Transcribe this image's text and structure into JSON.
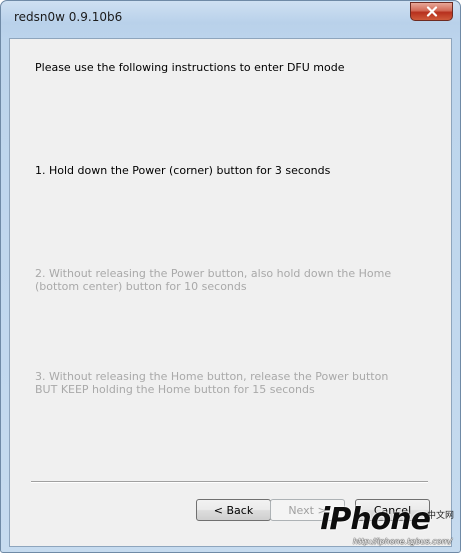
{
  "window": {
    "title": "redsn0w 0.9.10b6",
    "close_icon": "close-icon"
  },
  "content": {
    "heading": "Please use the following instructions to enter DFU mode",
    "steps": [
      {
        "lines": [
          "1. Hold down the Power (corner) button for 3 seconds"
        ],
        "active": true
      },
      {
        "lines": [
          "2. Without releasing the Power button, also hold down the Home",
          "(bottom center) button for 10 seconds"
        ],
        "active": false
      },
      {
        "lines": [
          "3. Without releasing the Home button, release the Power button",
          "BUT KEEP holding the Home button for 15 seconds"
        ],
        "active": false
      }
    ]
  },
  "buttons": {
    "back": "< Back",
    "next": "Next >",
    "cancel": "Cancel"
  },
  "watermark": {
    "logo": "iPhone",
    "cn": "中文网",
    "url": "http://iphone.tgbus.com/"
  },
  "colors": {
    "active_text": "#000000",
    "inactive_text": "#a9a9a9",
    "close_button": "#c8422c"
  }
}
